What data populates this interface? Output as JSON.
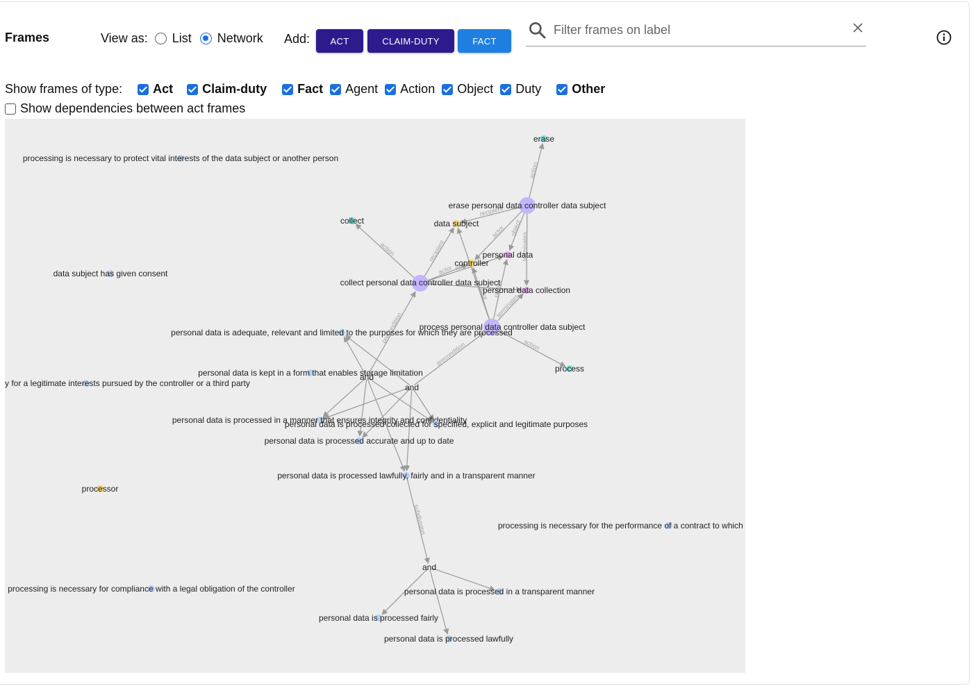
{
  "header": {
    "title": "Frames",
    "view_as_label": "View as:",
    "view_options": [
      {
        "label": "List",
        "selected": false
      },
      {
        "label": "Network",
        "selected": true
      }
    ],
    "add_label": "Add:",
    "add_buttons": {
      "act": "ACT",
      "claim_duty": "CLAIM-DUTY",
      "fact": "FACT"
    },
    "search_placeholder": "Filter frames on label",
    "search_value": ""
  },
  "filters": {
    "label": "Show frames of type:",
    "types": [
      {
        "label": "Act",
        "checked": true,
        "bold": true
      },
      {
        "label": "Claim-duty",
        "checked": true,
        "bold": true
      },
      {
        "label": "Fact",
        "checked": true,
        "bold": true
      },
      {
        "label": "Agent",
        "checked": true,
        "bold": false
      },
      {
        "label": "Action",
        "checked": true,
        "bold": false
      },
      {
        "label": "Object",
        "checked": true,
        "bold": false
      },
      {
        "label": "Duty",
        "checked": true,
        "bold": false
      },
      {
        "label": "Other",
        "checked": true,
        "bold": true
      }
    ],
    "dependencies": {
      "label": "Show dependencies between act frames",
      "checked": false
    }
  },
  "colors": {
    "act": "#c4b5fd",
    "action": "#7ee0d8",
    "fact": "#b3d0f5",
    "agent": "#f5d26b",
    "object": "#e8a7f0",
    "edge": "#999999",
    "graph_bg": "#ededed",
    "primary_dark": "#2d1b8e",
    "primary_blue": "#1e7fe0"
  },
  "network": {
    "nodes": [
      {
        "id": "erase",
        "label": "erase",
        "kind": "action"
      },
      {
        "id": "vital",
        "label": "processing is necessary to protect vital interests of the data subject or another person",
        "kind": "fact"
      },
      {
        "id": "erase_act",
        "label": "erase personal data controller data subject",
        "kind": "act"
      },
      {
        "id": "collect",
        "label": "collect",
        "kind": "action"
      },
      {
        "id": "data_subject",
        "label": "data subject",
        "kind": "agent"
      },
      {
        "id": "personal_data",
        "label": "personal data",
        "kind": "object"
      },
      {
        "id": "controller",
        "label": "controller",
        "kind": "agent"
      },
      {
        "id": "consent",
        "label": "data subject has given consent",
        "kind": "fact"
      },
      {
        "id": "collect_act",
        "label": "collect personal data controller data subject",
        "kind": "act"
      },
      {
        "id": "pd_collection",
        "label": "personal data collection",
        "kind": "object"
      },
      {
        "id": "process_act",
        "label": "process personal data controller data subject",
        "kind": "act"
      },
      {
        "id": "adequate",
        "label": "personal data is adequate, relevant and limited to the purposes for which they are processed",
        "kind": "fact"
      },
      {
        "id": "process",
        "label": "process",
        "kind": "action"
      },
      {
        "id": "storage",
        "label": "personal data is kept in a form that enables storage limitation",
        "kind": "fact"
      },
      {
        "id": "and1",
        "label": "and",
        "kind": "logic"
      },
      {
        "id": "legit",
        "label": "y for a legitimate interests pursued by the controller or a third party",
        "kind": "fact"
      },
      {
        "id": "and2",
        "label": "and",
        "kind": "logic"
      },
      {
        "id": "integrity",
        "label": "personal data is processed in a manner that ensures integrity and confidentiality",
        "kind": "fact"
      },
      {
        "id": "specified",
        "label": "personal data is processed collected for specified, explicit and legitimate purposes",
        "kind": "fact"
      },
      {
        "id": "accurate",
        "label": "personal data is processed accurate and up to date",
        "kind": "fact"
      },
      {
        "id": "lawful_fair_transp",
        "label": "personal data is processed lawfully, fairly and in a transparent manner",
        "kind": "fact"
      },
      {
        "id": "processor",
        "label": "processor",
        "kind": "agent"
      },
      {
        "id": "contract",
        "label": "processing is necessary for the performance of a contract to which",
        "kind": "fact"
      },
      {
        "id": "and3",
        "label": "and",
        "kind": "logic"
      },
      {
        "id": "legal",
        "label": "processing is necessary for compliance with a legal obligation of the controller",
        "kind": "fact"
      },
      {
        "id": "transparent",
        "label": "personal data is processed in a transparent manner",
        "kind": "fact"
      },
      {
        "id": "fairly",
        "label": "personal data is processed fairly",
        "kind": "fact"
      },
      {
        "id": "lawfully",
        "label": "personal data is processed lawfully",
        "kind": "fact"
      }
    ],
    "edges": [
      {
        "from": "erase_act",
        "to": "erase",
        "label": "action"
      },
      {
        "from": "erase_act",
        "to": "data_subject",
        "label": "recipient"
      },
      {
        "from": "erase_act",
        "to": "controller",
        "label": "actor"
      },
      {
        "from": "erase_act",
        "to": "personal_data",
        "label": "object"
      },
      {
        "from": "erase_act",
        "to": "pd_collection",
        "label": "terminates"
      },
      {
        "from": "collect_act",
        "to": "collect",
        "label": "action"
      },
      {
        "from": "collect_act",
        "to": "data_subject",
        "label": "recipient"
      },
      {
        "from": "collect_act",
        "to": "controller",
        "label": "actor"
      },
      {
        "from": "collect_act",
        "to": "personal_data",
        "label": "object"
      },
      {
        "from": "collect_act",
        "to": "pd_collection",
        "label": ""
      },
      {
        "from": "process_act",
        "to": "controller",
        "label": "actor"
      },
      {
        "from": "process_act",
        "to": "personal_data",
        "label": "object"
      },
      {
        "from": "process_act",
        "to": "data_subject",
        "label": ""
      },
      {
        "from": "process_act",
        "to": "pd_collection",
        "label": "terminates"
      },
      {
        "from": "process_act",
        "to": "process",
        "label": "action"
      },
      {
        "from": "and1",
        "to": "collect_act",
        "label": "precondition"
      },
      {
        "from": "and2",
        "to": "process_act",
        "label": "precondition"
      },
      {
        "from": "and1",
        "to": "adequate",
        "label": ""
      },
      {
        "from": "and1",
        "to": "integrity",
        "label": ""
      },
      {
        "from": "and1",
        "to": "specified",
        "label": ""
      },
      {
        "from": "and1",
        "to": "accurate",
        "label": ""
      },
      {
        "from": "and1",
        "to": "lawful_fair_transp",
        "label": ""
      },
      {
        "from": "and2",
        "to": "adequate",
        "label": ""
      },
      {
        "from": "and2",
        "to": "integrity",
        "label": ""
      },
      {
        "from": "and2",
        "to": "specified",
        "label": ""
      },
      {
        "from": "and2",
        "to": "accurate",
        "label": ""
      },
      {
        "from": "and2",
        "to": "lawful_fair_transp",
        "label": ""
      },
      {
        "from": "lawful_fair_transp",
        "to": "and3",
        "label": "subdivision"
      },
      {
        "from": "and3",
        "to": "transparent",
        "label": ""
      },
      {
        "from": "and3",
        "to": "fairly",
        "label": ""
      },
      {
        "from": "and3",
        "to": "lawfully",
        "label": ""
      }
    ]
  }
}
